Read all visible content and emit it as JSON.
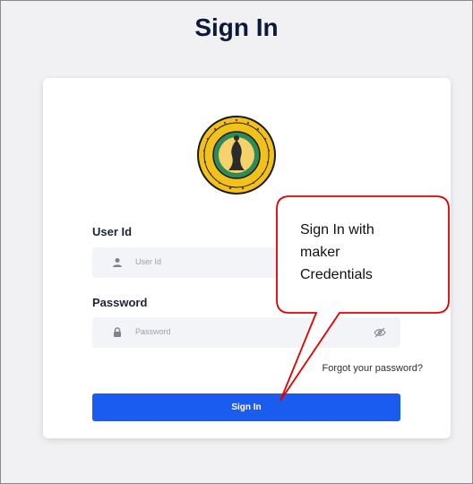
{
  "page": {
    "title": "Sign In"
  },
  "form": {
    "user_id": {
      "label": "User Id",
      "placeholder": "User Id"
    },
    "password": {
      "label": "Password",
      "placeholder": "Password"
    },
    "forgot_link": "Forgot your password?",
    "submit_label": "Sign In"
  },
  "callout": {
    "lines": [
      "Sign In with",
      "maker",
      "Credentials"
    ],
    "border_color": "#e00000"
  },
  "colors": {
    "primary_button": "#1a5cf0",
    "emblem_ring": "#f2c21b",
    "emblem_inner": "#2e8b57"
  },
  "icons": {
    "user": "user-icon",
    "lock": "lock-icon",
    "visibility": "eye-slash-icon"
  }
}
